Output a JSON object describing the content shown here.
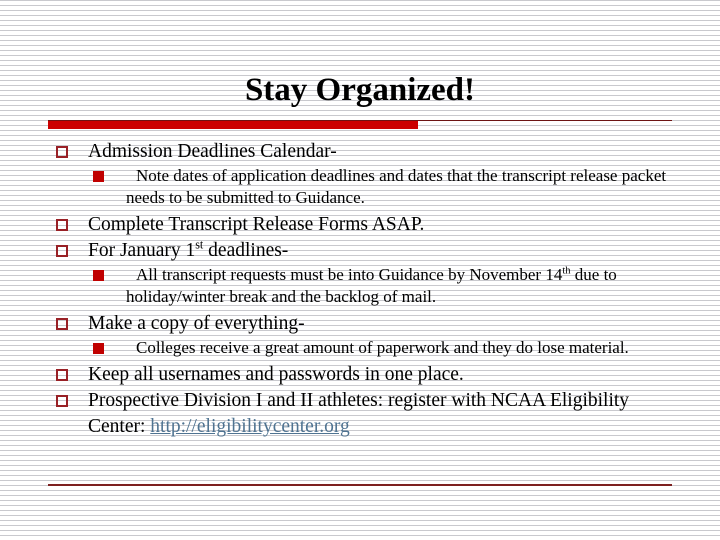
{
  "slide": {
    "title": "Stay Organized!",
    "accent_bar_color": "#cc0000",
    "rule_color": "#7d2020",
    "level1_marker_color": "#992026",
    "level2_marker_color": "#c00000",
    "link_color": "#4f7391",
    "text_color": "#000000",
    "background_color": "#ffffff",
    "background_stripe_color": "#c9c9ce"
  },
  "content": {
    "items": [
      {
        "level": 1,
        "marker": "hollow-square",
        "text": "Admission Deadlines Calendar-"
      },
      {
        "level": 2,
        "marker": "filled-square",
        "text": "Note dates of application deadlines and dates that the transcript release packet needs to be submitted to Guidance."
      },
      {
        "level": 1,
        "marker": "hollow-square",
        "text": "Complete Transcript Release Forms ASAP."
      },
      {
        "level": 1,
        "marker": "hollow-square",
        "text_before": "For January 1",
        "superscript": "st",
        "text_after": " deadlines-"
      },
      {
        "level": 2,
        "marker": "filled-square",
        "text_before": "All transcript requests must be into Guidance by November 14",
        "superscript": "th",
        "text_after": " due to holiday/winter break and the backlog of mail."
      },
      {
        "level": 1,
        "marker": "hollow-square",
        "text": "Make a copy of everything-"
      },
      {
        "level": 2,
        "marker": "filled-square",
        "text": "Colleges receive a great amount of paperwork and they do lose material."
      },
      {
        "level": 1,
        "marker": "hollow-square",
        "text": "Keep all usernames and passwords in one place."
      },
      {
        "level": 1,
        "marker": "hollow-square",
        "text_before": "Prospective Division I and II athletes: register with NCAA Eligibility Center: ",
        "link_text": "http://eligibilitycenter.org"
      }
    ]
  }
}
